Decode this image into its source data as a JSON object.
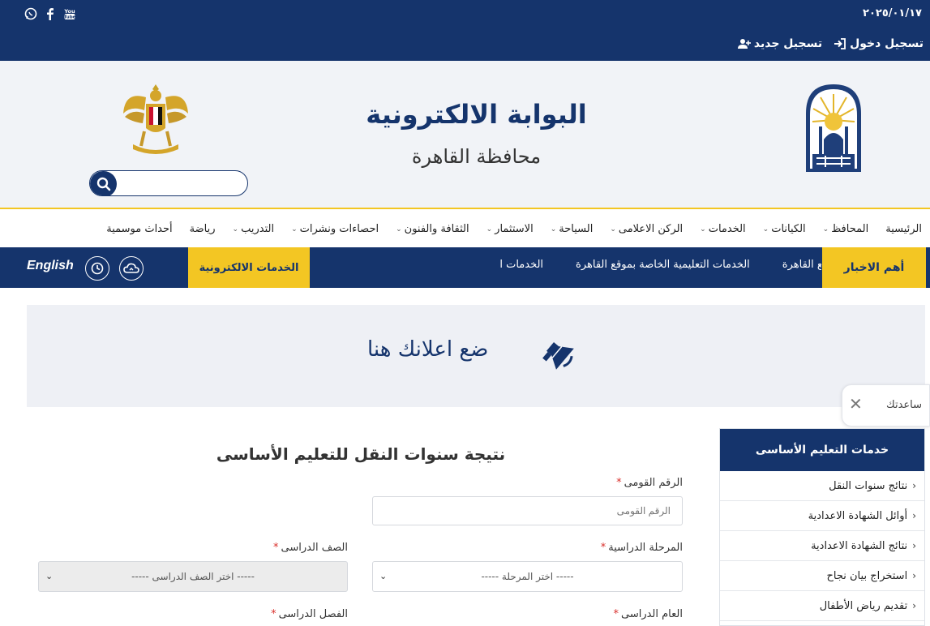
{
  "topbar": {
    "date": "٢٠٢٥/٠١/١٧",
    "login_label": "تسجيل دخول",
    "register_label": "تسجيل جديد",
    "social_icons": [
      "whatsapp-icon",
      "facebook-icon",
      "youtube-icon"
    ],
    "youtube_label": "You Tube"
  },
  "header": {
    "title": "البوابة الالكترونية",
    "subtitle": "محافظة القاهرة",
    "search_placeholder": ""
  },
  "nav": {
    "items": [
      {
        "label": "الرئيسية",
        "has_menu": false
      },
      {
        "label": "المحافظ",
        "has_menu": true
      },
      {
        "label": "الكيانات",
        "has_menu": true
      },
      {
        "label": "الخدمات",
        "has_menu": true
      },
      {
        "label": "الركن الاعلامى",
        "has_menu": true
      },
      {
        "label": "السياحة",
        "has_menu": true
      },
      {
        "label": "الاستثمار",
        "has_menu": true
      },
      {
        "label": "الثقافة والفنون",
        "has_menu": true
      },
      {
        "label": "احصاءات ونشرات",
        "has_menu": true
      },
      {
        "label": "التدريب",
        "has_menu": true
      },
      {
        "label": "رياضة",
        "has_menu": false
      },
      {
        "label": "أحداث موسمية",
        "has_menu": false
      }
    ]
  },
  "ticker": {
    "label": "أهم الاخبار",
    "items": [
      "خاصة بموقع القاهرة",
      "الخدمات التعليمية الخاصة بموقع القاهرة",
      "الخدمات ا"
    ],
    "eservices_label": "الخدمات الالكترونية",
    "english_label": "English"
  },
  "ad": {
    "text": "ضع اعلانك هنا"
  },
  "helper": {
    "text": "ساعدتك"
  },
  "form": {
    "title": "نتيجة سنوات النقل للتعليم الأساسى",
    "national_id_label": "الرقم القومى",
    "national_id_placeholder": "الرقم القومى",
    "stage_label": "المرحلة الدراسية",
    "stage_value": "----- اختر المرحلة -----",
    "grade_label": "الصف الدراسى",
    "grade_value": "----- اختر الصف الدراسى -----",
    "year_label": "العام الدراسى",
    "term_label": "الفصل الدراسى",
    "required_mark": "*"
  },
  "sidebar": {
    "title": "خدمات التعليم الأساسى",
    "items": [
      "نتائج سنوات النقل",
      "أوائل الشهادة الاعدادية",
      "نتائج الشهادة الاعدادية",
      "استخراج بيان نجاح",
      "تقديم رياض الأطفال"
    ]
  },
  "colors": {
    "primary": "#15346c",
    "accent": "#f3c623"
  }
}
